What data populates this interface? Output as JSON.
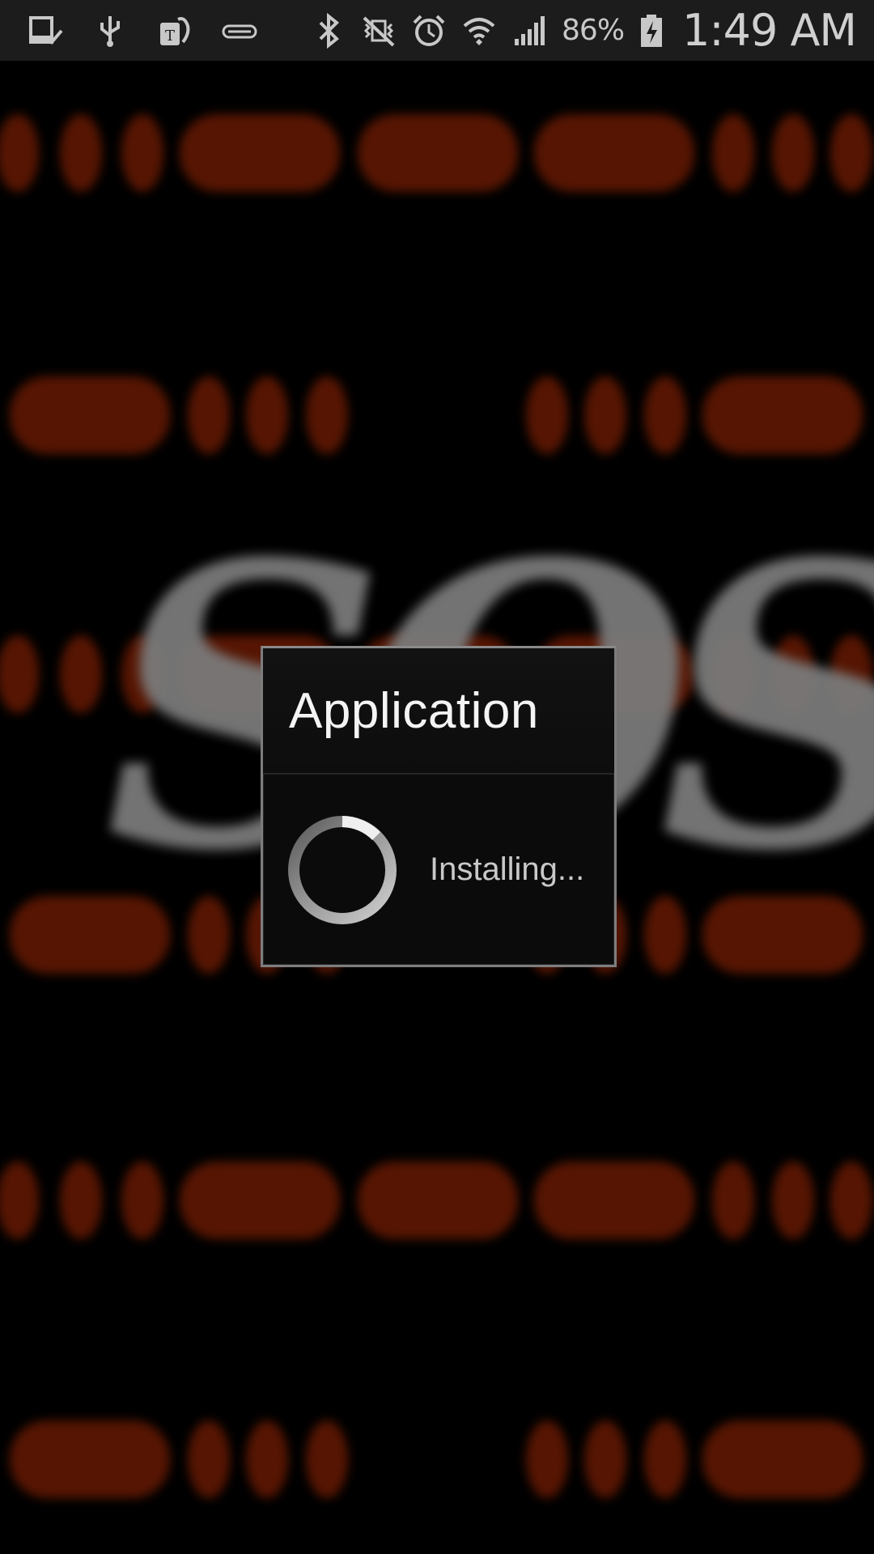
{
  "status_bar": {
    "icons": [
      "screenshot-icon",
      "usb-icon",
      "t-mobile-tag-icon",
      "download-icon",
      "bluetooth-icon",
      "vibrate-mute-icon",
      "alarm-icon",
      "wifi-icon",
      "signal-icon",
      "battery-charging-icon"
    ],
    "battery_percent": "86%",
    "time": "1:49 AM"
  },
  "wallpaper": {
    "text": "SOS",
    "colors": {
      "morse": "#561502",
      "text": "#7a7a7a",
      "background": "#000000"
    }
  },
  "dialog": {
    "title": "Application",
    "message": "Installing...",
    "spinner_icon": "progress-spinner-icon"
  }
}
